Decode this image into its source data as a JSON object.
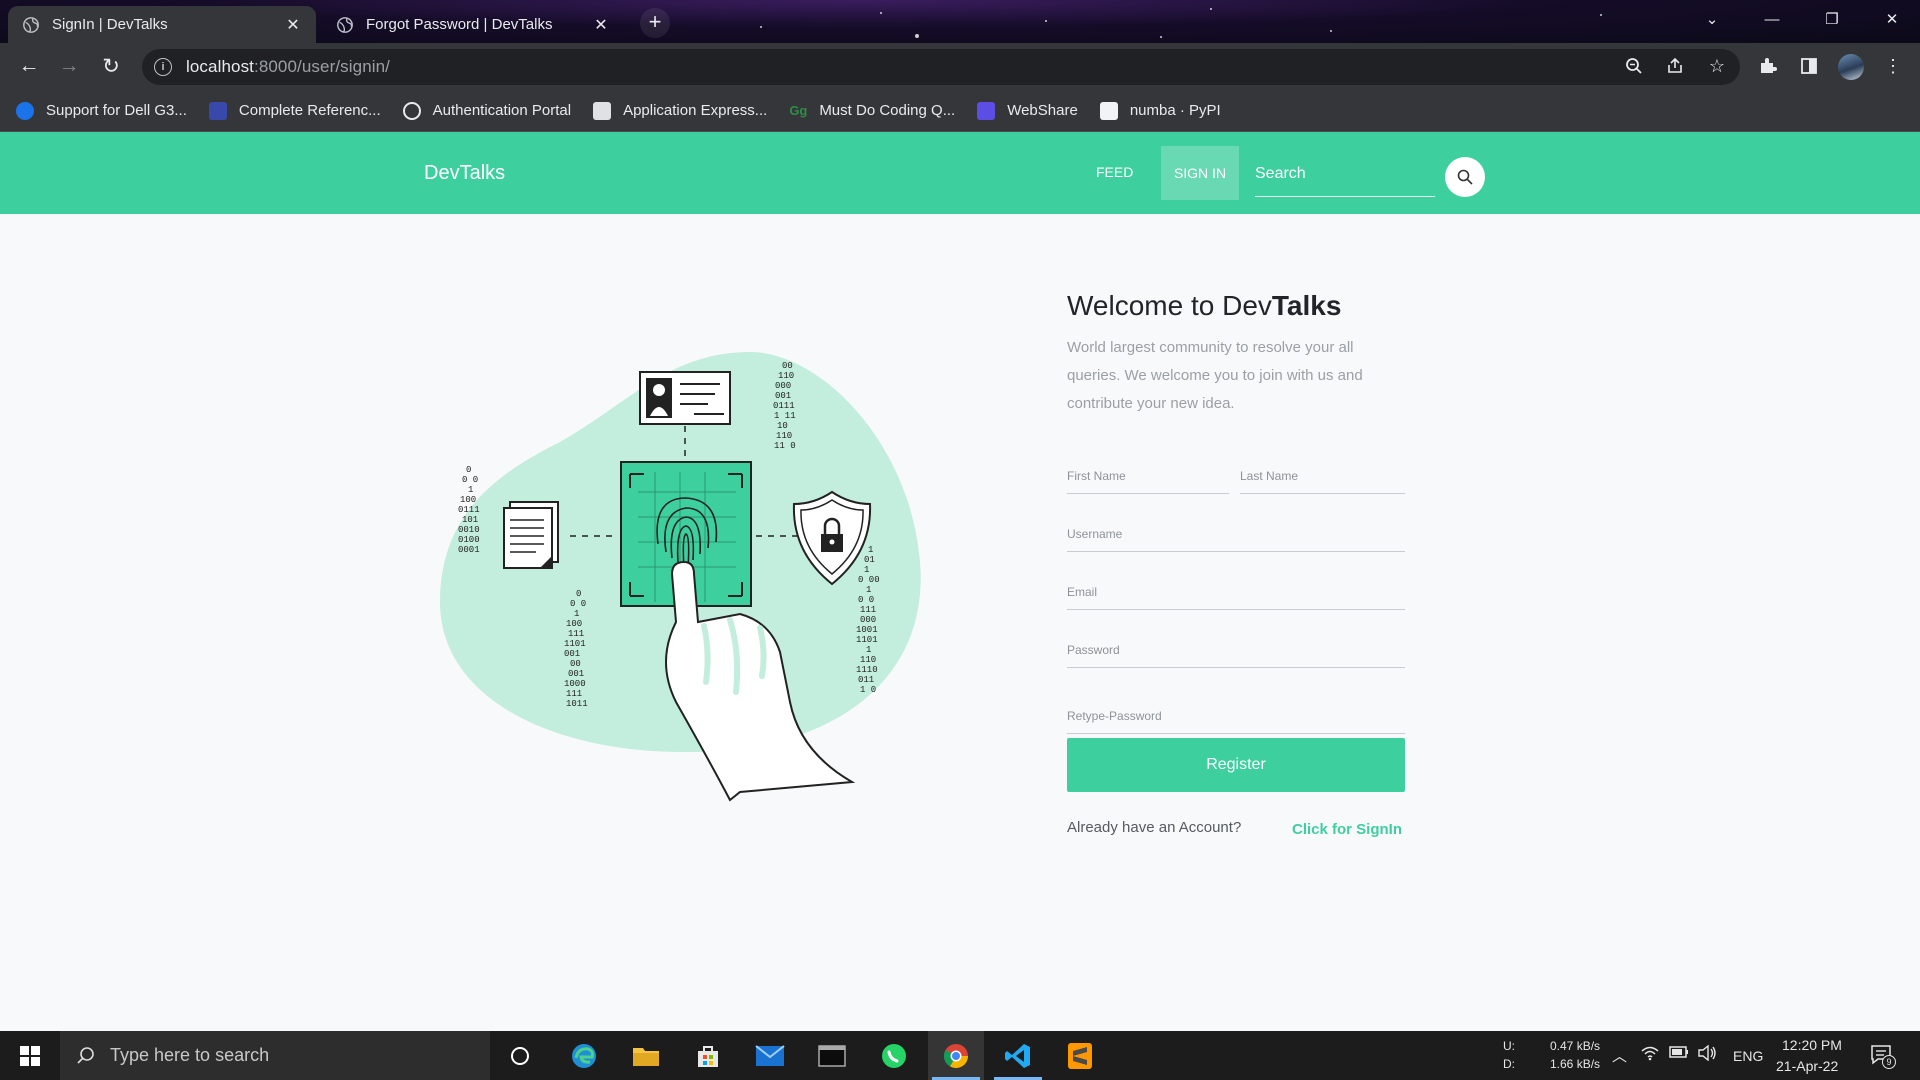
{
  "browser": {
    "tabs": [
      {
        "title": "SignIn | DevTalks",
        "active": true
      },
      {
        "title": "Forgot Password | DevTalks",
        "active": false
      }
    ],
    "new_tab": "+",
    "url_host": "localhost",
    "url_rest": ":8000/user/signin/",
    "bookmarks": [
      {
        "label": "Support for Dell G3...",
        "color": "#1a73e8"
      },
      {
        "label": "Complete Referenc...",
        "color": "#3949ab"
      },
      {
        "label": "Authentication Portal",
        "color": "#e8eaed"
      },
      {
        "label": "Application Express...",
        "color": "#dfe1e5"
      },
      {
        "label": "Must Do Coding Q...",
        "color": "#2f8d46"
      },
      {
        "label": "WebShare",
        "color": "#5c4ee5"
      },
      {
        "label": "numba · PyPI",
        "color": "#f1f3f4"
      }
    ]
  },
  "site": {
    "brand": "DevTalks",
    "nav": {
      "feed": "FEED",
      "signin": "SIGN IN"
    },
    "search_placeholder": "Search",
    "accent": "#3ecf9e"
  },
  "form": {
    "welcome_prefix": "Welcome to Dev",
    "welcome_bold": "Talks",
    "description": "World largest community to resolve your all queries. We welcome you to join with us and contribute your new idea.",
    "fields": {
      "first_name": "First Name",
      "last_name": "Last Name",
      "username": "Username",
      "email": "Email",
      "password": "Password",
      "retype_password": "Retype-Password"
    },
    "register": "Register",
    "already": "Already have an Account?",
    "signin_link": "Click for SignIn"
  },
  "taskbar": {
    "search_placeholder": "Type here to search",
    "net_up_label": "U:",
    "net_down_label": "D:",
    "net_up": "0.47 kB/s",
    "net_down": "1.66 kB/s",
    "lang": "ENG",
    "time": "12:20 PM",
    "date": "21-Apr-22",
    "notif_count": "9"
  }
}
